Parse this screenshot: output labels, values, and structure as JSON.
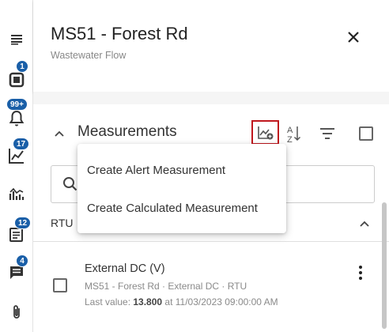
{
  "rail": {
    "items": [
      {
        "icon": "lines-icon"
      },
      {
        "icon": "device-icon",
        "badge": "1"
      },
      {
        "icon": "bell-icon",
        "badge": "99+"
      },
      {
        "icon": "trend-chart-icon",
        "badge": "17"
      },
      {
        "icon": "analytics-icon"
      },
      {
        "icon": "report-icon",
        "badge": "12"
      },
      {
        "icon": "comment-icon",
        "badge": "4"
      },
      {
        "icon": "attachment-icon"
      }
    ],
    "badge_color": "#1a5fa8"
  },
  "header": {
    "title": "MS51 - Forest Rd",
    "subtitle": "Wastewater Flow"
  },
  "section": {
    "title": "Measurements",
    "highlight_color": "#c0181e"
  },
  "group": {
    "label": "RTU"
  },
  "menu": {
    "items": [
      {
        "label": "Create Alert Measurement"
      },
      {
        "label": "Create Calculated Measurement"
      }
    ]
  },
  "measurement": {
    "name": "External DC (V)",
    "path": "MS51 - Forest Rd · External DC · RTU",
    "last_value_prefix": "Last value: ",
    "last_value": "13.800",
    "last_value_suffix": " at 11/03/2023 09:00:00 AM"
  }
}
